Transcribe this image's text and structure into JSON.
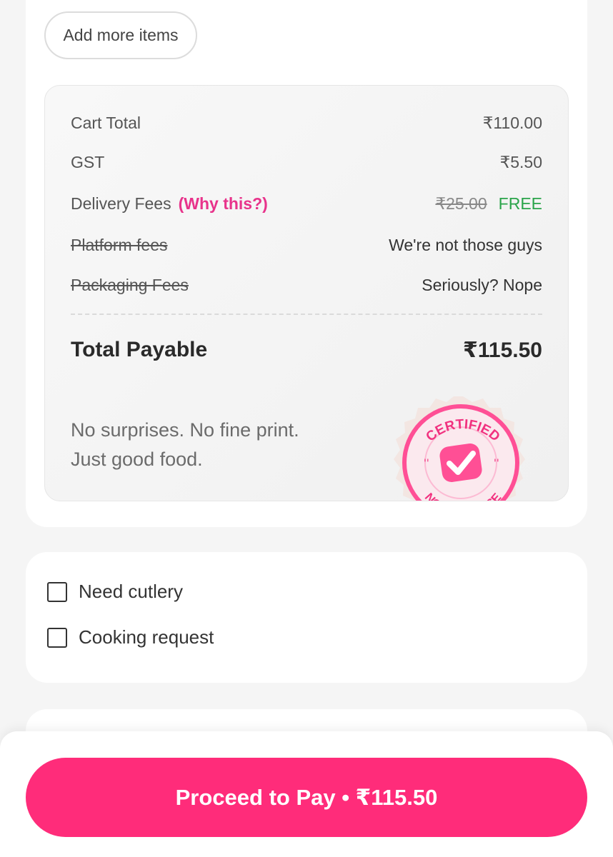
{
  "cart": {
    "add_more_label": "Add more items"
  },
  "bill": {
    "cart_total_label": "Cart Total",
    "cart_total_value": "₹110.00",
    "gst_label": "GST",
    "gst_value": "₹5.50",
    "delivery_label": "Delivery Fees",
    "delivery_why": "(Why this?)",
    "delivery_old": "₹25.00",
    "delivery_value": "FREE",
    "platform_label": "Platform fees",
    "platform_value": "We're not those guys",
    "packaging_label": "Packaging Fees",
    "packaging_value": "Seriously? Nope",
    "total_label": "Total Payable",
    "total_value": "₹115.50",
    "tagline_1": "No surprises. No fine print.",
    "tagline_2": "Just good food.",
    "badge_top": "CERTIFIED",
    "badge_bottom": "NO NONSENSE"
  },
  "options": {
    "cutlery_label": "Need cutlery",
    "cooking_label": "Cooking request"
  },
  "footer": {
    "pay_label": "Proceed to Pay • ₹115.50"
  },
  "colors": {
    "accent": "#ff2c7a",
    "link": "#e8338b",
    "free": "#2aa44a"
  }
}
